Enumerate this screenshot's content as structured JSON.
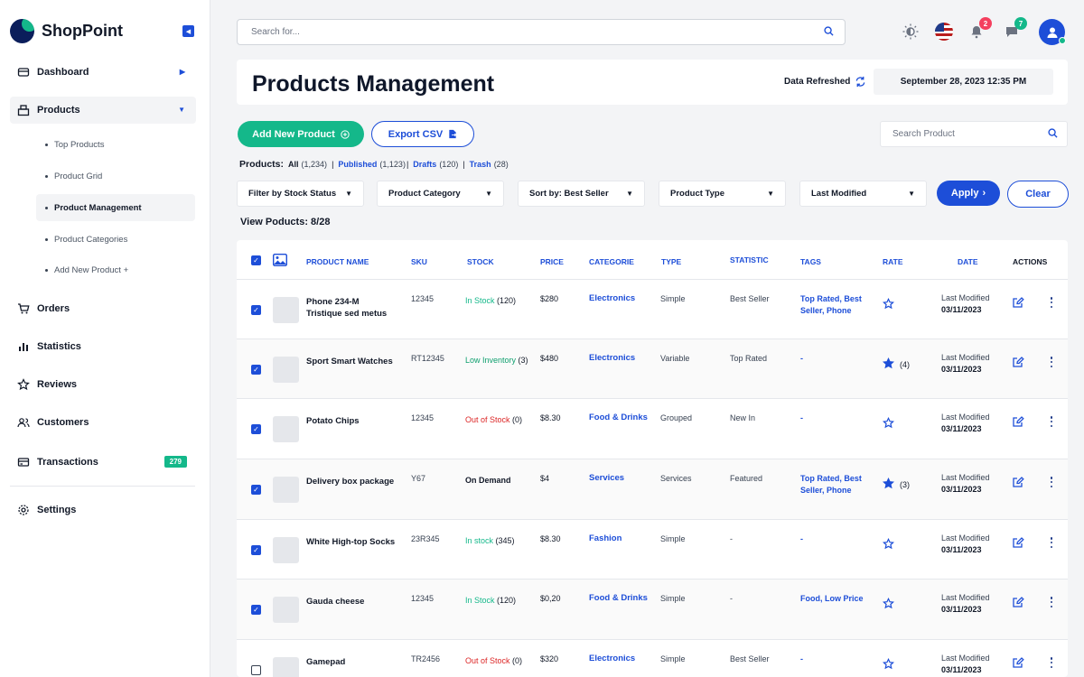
{
  "brand": {
    "name": "ShopPoint"
  },
  "sidebar": {
    "items": [
      {
        "label": "Dashboard",
        "icon": "dashboard-icon"
      },
      {
        "label": "Products",
        "icon": "products-icon"
      },
      {
        "label": "Orders",
        "icon": "cart-icon"
      },
      {
        "label": "Statistics",
        "icon": "statistics-icon"
      },
      {
        "label": "Reviews",
        "icon": "star-icon"
      },
      {
        "label": "Customers",
        "icon": "customers-icon"
      },
      {
        "label": "Transactions",
        "icon": "transactions-icon",
        "badge": "279"
      },
      {
        "label": "Settings",
        "icon": "gear-icon"
      }
    ],
    "products_sub": [
      {
        "label": "Top Products"
      },
      {
        "label": "Product Grid"
      },
      {
        "label": "Product Management"
      },
      {
        "label": "Product Categories"
      },
      {
        "label": "Add New Product +"
      }
    ]
  },
  "topbar": {
    "search_placeholder": "Search for...",
    "notifications_count": "2",
    "messages_count": "7"
  },
  "header": {
    "title": "Products Management",
    "refresh_label": "Data Refreshed",
    "datetime": "September 28, 2023 12:35 PM"
  },
  "actions": {
    "add_label": "Add New Product",
    "export_label": "Export CSV",
    "search_placeholder": "Search Product"
  },
  "status": {
    "label": "Products:",
    "all_label": "All",
    "all_count": "(1,234)",
    "published_label": "Published",
    "published_count": "(1,123)",
    "drafts_label": "Drafts",
    "drafts_count": "(120)",
    "trash_label": "Trash",
    "trash_count": "(28)"
  },
  "filters": {
    "stock_status": "Filter by Stock Status",
    "category": "Product Category",
    "sort_prefix": "Sort by:",
    "sort_value": "Best Seller",
    "type": "Product Type",
    "modified": "Last Modified",
    "apply_label": "Apply",
    "clear_label": "Clear"
  },
  "view_count": "View Poducts: 8/28",
  "colors": {
    "accent_blue": "#1d4ed8",
    "accent_green": "#14b88a",
    "danger_red": "#dc2626",
    "navy": "#0b1e5b"
  },
  "table": {
    "headers": {
      "name": "PRODUCT  NAME",
      "sku": "SKU",
      "stock": "STOCK",
      "price": "PRICE",
      "category": "CATEGORIE",
      "type": "TYPE",
      "statistic": "STATISTIC",
      "tags": "TAGS",
      "rate": "RATE",
      "date": "DATE",
      "actions": "ACTIONS"
    },
    "rows": [
      {
        "name": "Phone 234-M Tristique sed metus",
        "sku": "12345",
        "stock_label": "In Stock",
        "stock_count": "(120)",
        "stock_status": "green",
        "price": "$280",
        "category": "Electronics",
        "type": "Simple",
        "statistic": "Best Seller",
        "tags": "Top Rated, Best Seller, Phone",
        "rate_filled": false,
        "rate_count": "",
        "date_label": "Last Modified",
        "date": "03/11/2023",
        "checked": true
      },
      {
        "name": "Sport Smart Watches",
        "sku": "RT12345",
        "stock_label": "Low Inventory",
        "stock_count": "(3)",
        "stock_status": "amber",
        "price": "$480",
        "category": "Electronics",
        "type": "Variable",
        "statistic": "Top Rated",
        "tags": "-",
        "rate_filled": true,
        "rate_count": "(4)",
        "date_label": "Last Modified",
        "date": "03/11/2023",
        "checked": true
      },
      {
        "name": "Potato Chips",
        "sku": "12345",
        "stock_label": "Out of Stock",
        "stock_count": "(0)",
        "stock_status": "red",
        "price": "$8.30",
        "category": "Food & Drinks",
        "type": "Grouped",
        "statistic": "New In",
        "tags": "-",
        "rate_filled": false,
        "rate_count": "",
        "date_label": "Last Modified",
        "date": "03/11/2023",
        "checked": true
      },
      {
        "name": "Delivery  box package",
        "sku": "Y67",
        "stock_label": "On Demand",
        "stock_count": "",
        "stock_status": "dark",
        "price": "$4",
        "category": "Services",
        "type": "Services",
        "statistic": "Featured",
        "tags": "Top Rated, Best Seller, Phone",
        "rate_filled": true,
        "rate_count": "(3)",
        "date_label": "Last Modified",
        "date": "03/11/2023",
        "checked": true
      },
      {
        "name": "White High-top Socks",
        "sku": "23R345",
        "stock_label": "In stock",
        "stock_count": "(345)",
        "stock_status": "green",
        "price": "$8.30",
        "category": "Fashion",
        "type": "Simple",
        "statistic": "-",
        "tags": "-",
        "rate_filled": false,
        "rate_count": "",
        "date_label": "Last Modified",
        "date": "03/11/2023",
        "checked": true
      },
      {
        "name": "Gauda cheese",
        "sku": "12345",
        "stock_label": "In Stock",
        "stock_count": "(120)",
        "stock_status": "green",
        "price": "$0,20",
        "category": "Food & Drinks",
        "type": "Simple",
        "statistic": "-",
        "tags": "Food, Low Price",
        "rate_filled": false,
        "rate_count": "",
        "date_label": "Last Modified",
        "date": "03/11/2023",
        "checked": true
      },
      {
        "name": "Gamepad",
        "sku": "TR2456",
        "stock_label": "Out of Stock",
        "stock_count": "(0)",
        "stock_status": "red",
        "price": "$320",
        "category": "Electronics",
        "type": "Simple",
        "statistic": "Best Seller",
        "tags": "-",
        "rate_filled": false,
        "rate_count": "",
        "date_label": "Last Modified",
        "date": "03/11/2023",
        "checked": false
      }
    ]
  }
}
